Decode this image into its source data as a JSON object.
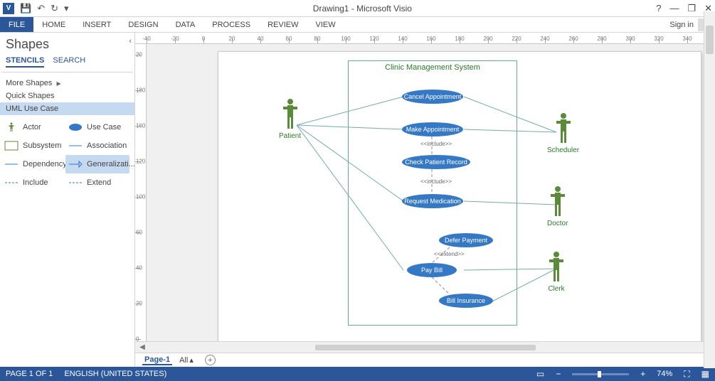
{
  "window": {
    "title": "Drawing1 - Microsoft Visio"
  },
  "qat": {
    "save": "💾",
    "undo": "↶",
    "redo": "↻"
  },
  "window_controls": {
    "help": "?",
    "min": "—",
    "restore": "❐",
    "close": "✕"
  },
  "ribbon": {
    "file": "FILE",
    "tabs": [
      "HOME",
      "INSERT",
      "DESIGN",
      "DATA",
      "PROCESS",
      "REVIEW",
      "VIEW"
    ],
    "signin": "Sign in"
  },
  "shapes_pane": {
    "title": "Shapes",
    "tabs": {
      "stencils": "STENCILS",
      "search": "SEARCH"
    },
    "categories": {
      "more_shapes": "More Shapes",
      "quick_shapes": "Quick Shapes",
      "uml_use_case": "UML Use Case"
    },
    "shapes": {
      "actor": "Actor",
      "use_case": "Use Case",
      "subsystem": "Subsystem",
      "association": "Association",
      "dependency": "Dependency",
      "generalization": "Generalizati...",
      "include": "Include",
      "extend": "Extend"
    }
  },
  "ruler_top_labels": [
    "-40",
    "-20",
    "0",
    "20",
    "40",
    "60",
    "80",
    "100",
    "120",
    "140",
    "160",
    "180",
    "200",
    "220",
    "240",
    "260",
    "280",
    "300",
    "320",
    "340"
  ],
  "ruler_left_labels": [
    "20",
    "180",
    "160",
    "120",
    "100",
    "60",
    "40",
    "20",
    "0"
  ],
  "diagram": {
    "subsystem_title": "Clinic Management System",
    "actors": {
      "patient": "Patient",
      "scheduler": "Scheduler",
      "doctor": "Doctor",
      "clerk": "Clerk"
    },
    "usecases": {
      "cancel_appt": "Cancel Appointment",
      "make_appt": "Make Appointment",
      "check_record": "Check Patient Record",
      "request_med": "Request Medication",
      "defer_payment": "Defer Payment",
      "pay_bill": "Pay Bill",
      "bill_insurance": "Bill Insurance"
    },
    "labels": {
      "include1": "<<include>>",
      "include2": "<<include>>",
      "extend": "<<extend>>"
    }
  },
  "page_tabs": {
    "page1": "Page-1",
    "all": "All",
    "dropdown": "▴"
  },
  "status": {
    "page": "PAGE 1 OF 1",
    "lang": "ENGLISH (UNITED STATES)",
    "zoom_pct": "74%"
  }
}
